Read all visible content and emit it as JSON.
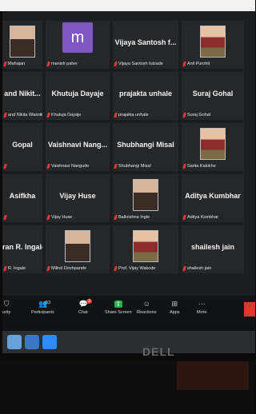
{
  "tiles": [
    {
      "type": "photo",
      "center": "",
      "label": "Mahajan"
    },
    {
      "type": "avatar",
      "center": "",
      "avatar_letter": "m",
      "label": "manish palve"
    },
    {
      "type": "text",
      "center": "Vijaya Santosh f...",
      "label": "Vijaya Santosh fulzade"
    },
    {
      "type": "photo",
      "center": "",
      "label": "Anil Purohit"
    },
    {
      "type": "text",
      "center": "and Nikit...",
      "label": "and Nikita Wasnik"
    },
    {
      "type": "text",
      "center": "Khutuja Dayaje",
      "label": "Khutuja Dayaje"
    },
    {
      "type": "text",
      "center": "prajakta unhale",
      "label": "prajakta unhale"
    },
    {
      "type": "text",
      "center": "Suraj Gohal",
      "label": "Suraj Gohal"
    },
    {
      "type": "text",
      "center": "Gopal",
      "label": ""
    },
    {
      "type": "text",
      "center": "Vaishnavi Nang...",
      "label": "Vaishnavi Nangude"
    },
    {
      "type": "text",
      "center": "Shubhangi Misal",
      "label": "Shubhangi Misal"
    },
    {
      "type": "photo",
      "center": "",
      "label": "Sarita Kalokhe"
    },
    {
      "type": "text",
      "center": "Asifkha",
      "label": ""
    },
    {
      "type": "text",
      "center": "Vijay Huse",
      "label": "Vijay Huse"
    },
    {
      "type": "photo",
      "center": "",
      "label": "Balkrishna Ingle"
    },
    {
      "type": "text",
      "center": "Aditya Kumbhar",
      "label": "Aditya Kumbhar"
    },
    {
      "type": "text",
      "center": "ran R. Ingale",
      "label": "R. Ingale"
    },
    {
      "type": "photo",
      "center": "",
      "label": "Milind Deshpande"
    },
    {
      "type": "photo",
      "center": "",
      "label": "Prof. Vijay Wakode"
    },
    {
      "type": "text",
      "center": "shailesh jain",
      "label": "shailesh jain"
    }
  ],
  "toolbar": [
    {
      "label": "urity",
      "icon": "shield-icon",
      "glyph": "⛉"
    },
    {
      "label": "Participants",
      "icon": "participants-icon",
      "glyph": "👥",
      "count": "53"
    },
    {
      "label": "Chat",
      "icon": "chat-icon",
      "glyph": "💬",
      "badge": "3"
    },
    {
      "label": "Share Screen",
      "icon": "share-screen-icon",
      "glyph": "⇪"
    },
    {
      "label": "Reactions",
      "icon": "reactions-icon",
      "glyph": "☺"
    },
    {
      "label": "Apps",
      "icon": "apps-icon",
      "glyph": "⊞"
    },
    {
      "label": "More",
      "icon": "more-icon",
      "glyph": "···"
    }
  ],
  "bezel_logo": "DELL",
  "colors": {
    "accent_red": "#e43a2f",
    "share_green": "#23b14d",
    "avatar_purple": "#7e57c2"
  }
}
